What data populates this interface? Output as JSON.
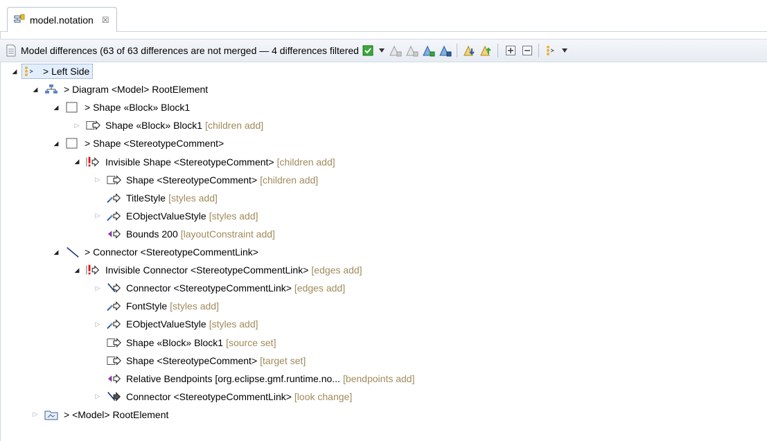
{
  "tab": {
    "title": "model.notation",
    "close_glyph": "☒"
  },
  "toolbar": {
    "title": "Model differences  (63 of 63 differences are not merged — 4 differences filtered",
    "buttons": [
      {
        "name": "filter-checkbox-icon"
      },
      {
        "name": "dropdown-arrow-icon"
      },
      {
        "name": "accept-change-icon"
      },
      {
        "name": "reject-change-icon"
      },
      {
        "name": "accept-all-icon"
      },
      {
        "name": "reject-all-icon"
      },
      {
        "name": "next-difference-icon"
      },
      {
        "name": "previous-difference-icon"
      },
      {
        "name": "expand-all-icon"
      },
      {
        "name": "collapse-all-icon"
      },
      {
        "name": "group-icon"
      }
    ]
  },
  "tree": [
    {
      "indent": 0,
      "twisty": "open",
      "icon": "side-icon",
      "label": "> Left Side",
      "feature": "",
      "selected": true
    },
    {
      "indent": 1,
      "twisty": "open",
      "icon": "diagram-icon",
      "label": "> Diagram <Model> RootElement",
      "feature": ""
    },
    {
      "indent": 2,
      "twisty": "open",
      "icon": "shape-icon",
      "label": "> Shape «Block» Block1",
      "feature": ""
    },
    {
      "indent": 3,
      "twisty": "closed",
      "icon": "shape-add-icon",
      "label": "Shape «Block» Block1",
      "feature": "[children add]"
    },
    {
      "indent": 2,
      "twisty": "open",
      "icon": "shape-icon",
      "label": "> Shape <StereotypeComment>",
      "feature": ""
    },
    {
      "indent": 3,
      "twisty": "open",
      "icon": "conflict-add-icon",
      "label": "Invisible Shape <StereotypeComment>",
      "feature": "[children add]"
    },
    {
      "indent": 4,
      "twisty": "closed",
      "icon": "shape-add-icon",
      "label": "Shape <StereotypeComment>",
      "feature": "[children add]"
    },
    {
      "indent": 4,
      "twisty": "none",
      "icon": "style-add-icon",
      "label": "TitleStyle",
      "feature": "[styles add]"
    },
    {
      "indent": 4,
      "twisty": "closed",
      "icon": "style-add-icon",
      "label": "EObjectValueStyle",
      "feature": "[styles add]"
    },
    {
      "indent": 4,
      "twisty": "none",
      "icon": "bounds-add-icon",
      "label": "Bounds 200",
      "feature": "[layoutConstraint add]"
    },
    {
      "indent": 2,
      "twisty": "open",
      "icon": "connector-icon",
      "label": "> Connector <StereotypeCommentLink>",
      "feature": ""
    },
    {
      "indent": 3,
      "twisty": "open",
      "icon": "conflict-add-icon",
      "label": "Invisible Connector <StereotypeCommentLink>",
      "feature": "[edges add]"
    },
    {
      "indent": 4,
      "twisty": "closed",
      "icon": "connector-add-icon",
      "label": "Connector <StereotypeCommentLink>",
      "feature": "[edges add]"
    },
    {
      "indent": 4,
      "twisty": "none",
      "icon": "style-add-icon",
      "label": "FontStyle",
      "feature": "[styles add]"
    },
    {
      "indent": 4,
      "twisty": "closed",
      "icon": "style-add-icon",
      "label": "EObjectValueStyle",
      "feature": "[styles add]"
    },
    {
      "indent": 4,
      "twisty": "none",
      "icon": "shape-add-icon",
      "label": "Shape «Block» Block1",
      "feature": "[source set]"
    },
    {
      "indent": 4,
      "twisty": "none",
      "icon": "shape-add-icon",
      "label": "Shape <StereotypeComment>",
      "feature": "[target set]"
    },
    {
      "indent": 4,
      "twisty": "none",
      "icon": "bounds-add-icon",
      "label": "Relative Bendpoints [org.eclipse.gmf.runtime.no...",
      "feature": "[bendpoints add]"
    },
    {
      "indent": 4,
      "twisty": "closed",
      "icon": "connector-change-icon",
      "label": "Connector <StereotypeCommentLink>",
      "feature": "[look change]"
    },
    {
      "indent": 1,
      "twisty": "closed",
      "icon": "model-icon",
      "label": "> <Model> RootElement",
      "feature": ""
    }
  ]
}
